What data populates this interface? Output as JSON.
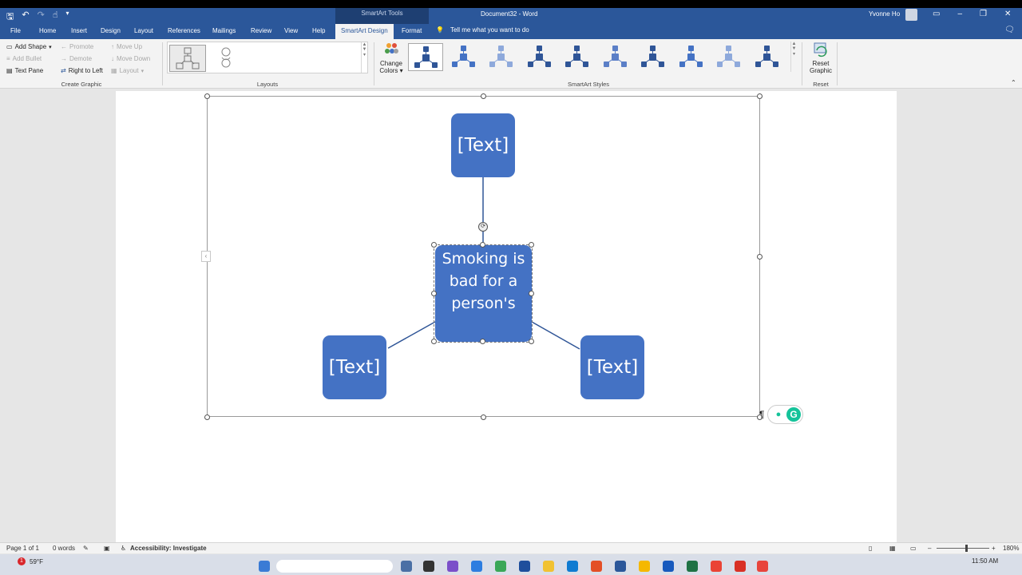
{
  "titlebar": {
    "context_tools": "SmartArt Tools",
    "document_title": "Document32  -  Word",
    "user_name": "Yvonne Ho"
  },
  "tabs": [
    "File",
    "Home",
    "Insert",
    "Design",
    "Layout",
    "References",
    "Mailings",
    "Review",
    "View",
    "Help",
    "SmartArt Design",
    "Format"
  ],
  "active_tab": "SmartArt Design",
  "tell_me": "Tell me what you want to do",
  "create_graphic": {
    "add_shape": "Add Shape",
    "add_bullet": "Add Bullet",
    "text_pane": "Text Pane",
    "promote": "Promote",
    "demote": "Demote",
    "right_to_left": "Right to Left",
    "move_up": "Move Up",
    "move_down": "Move Down",
    "layout": "Layout",
    "label": "Create Graphic"
  },
  "layouts": {
    "label": "Layouts"
  },
  "smartart_styles": {
    "change_colors_line1": "Change",
    "change_colors_line2": "Colors",
    "label": "SmartArt Styles"
  },
  "reset": {
    "line1": "Reset",
    "line2": "Graphic",
    "label": "Reset"
  },
  "smartart": {
    "top_node": "[Text]",
    "center_node": "Smoking is bad for a person's",
    "left_node": "[Text]",
    "right_node": "[Text]",
    "node_color": "#4472c4"
  },
  "statusbar": {
    "page": "Page 1 of 1",
    "words": "0 words",
    "accessibility": "Accessibility: Investigate",
    "zoom": "180%"
  },
  "taskbar": {
    "weather": "59°F",
    "weather_badge": "1",
    "clock": "11:50 AM"
  },
  "colors": {
    "word_blue": "#2b579a",
    "ribbon_bg": "#f3f3f3",
    "grammarly_green": "#15c39a"
  }
}
